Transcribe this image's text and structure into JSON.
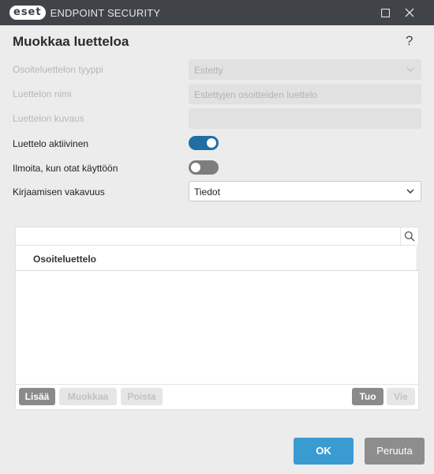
{
  "titlebar": {
    "logo": "eset",
    "product": "ENDPOINT SECURITY",
    "icons": [
      "maximize-icon",
      "close-icon"
    ]
  },
  "dialog": {
    "title": "Muokkaa luetteloa",
    "help": "?"
  },
  "form": {
    "list_type": {
      "label": "Osoiteluettelon tyyppi",
      "value": "Estetty",
      "disabled": true
    },
    "list_name": {
      "label": "Luettelon nimi",
      "value": "Estettyjen osoitteiden luettelo",
      "disabled": true
    },
    "list_description": {
      "label": "Luettelon kuvaus",
      "value": "",
      "disabled": true
    },
    "list_active": {
      "label": "Luettelo aktiivinen",
      "state": "on"
    },
    "notify_on_use": {
      "label": "Ilmoita, kun otat käyttöön",
      "state": "off"
    },
    "logging_severity": {
      "label": "Kirjaamisen vakavuus",
      "value": "Tiedot"
    }
  },
  "list_panel": {
    "search_placeholder": "",
    "column_header": "Osoiteluettelo",
    "rows": [],
    "buttons": {
      "add": "Lisää",
      "edit": "Muokkaa",
      "remove": "Poista",
      "import": "Tuo",
      "export": "Vie"
    }
  },
  "footer": {
    "ok": "OK",
    "cancel": "Peruuta"
  },
  "colors": {
    "titlebar": "#404448",
    "toggle_on": "#1f6fa5",
    "toggle_off": "#7d7d7d",
    "ok_button": "#3a9bd3",
    "cancel_button": "#8d8d8d"
  }
}
